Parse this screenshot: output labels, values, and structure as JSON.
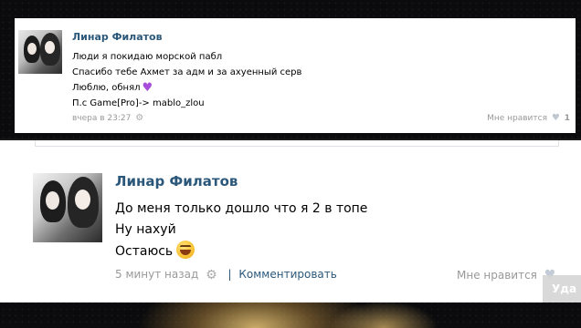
{
  "post1": {
    "author": "Линар Филатов",
    "lines": [
      "Люди я покидаю морской пабл",
      "Спасибо тебе Ахмет за адм и за ахуенный серв",
      "Люблю, обнял",
      "П.с Game[Pro]-> mablo_zlou"
    ],
    "line3_emoji": "♥",
    "timestamp": "вчера в 23:27",
    "like_label": "Мне нравится",
    "like_count": "1"
  },
  "post2": {
    "author": "Линар Филатов",
    "lines": [
      "До меня только дошло что я 2 в топе",
      "Ну нахуй",
      "Остаюсь"
    ],
    "timestamp": "5 минут назад",
    "separator": "|",
    "comment_label": "Комментировать",
    "like_label": "Мне нравится",
    "overlay_label": "Уда"
  },
  "icons": {
    "gear": "⚙",
    "heart": "♥"
  },
  "colors": {
    "author_link": "#2b587a",
    "meta_gray": "#999999",
    "background": "#0b0b0d"
  }
}
